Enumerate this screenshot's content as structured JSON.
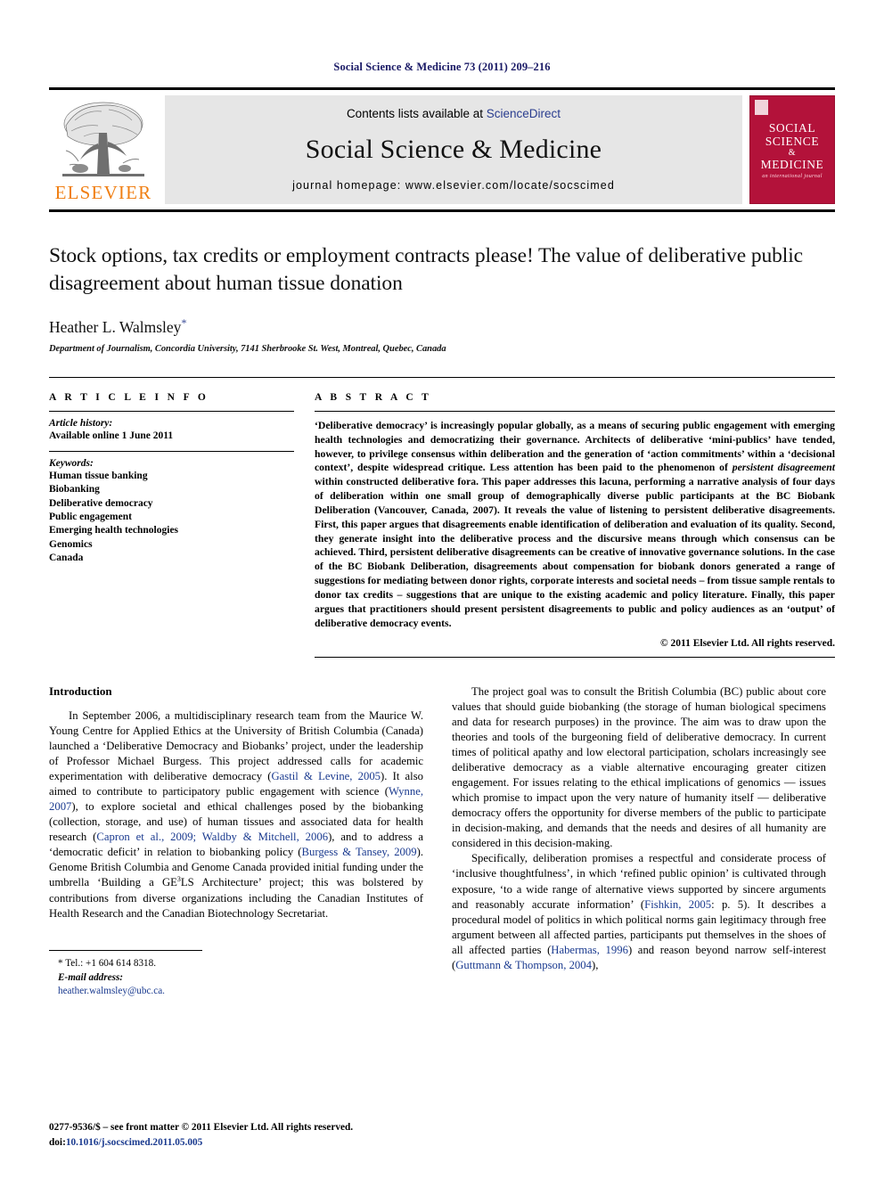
{
  "running_head": "Social Science & Medicine 73 (2011) 209–216",
  "masthead": {
    "publisher_name": "ELSEVIER",
    "contents_prefix": "Contents lists available at ",
    "sciencedirect": "ScienceDirect",
    "journal_name": "Social Science & Medicine",
    "homepage": "journal homepage: www.elsevier.com/locate/socscimed",
    "cover": {
      "line1": "SOCIAL",
      "line2": "SCIENCE",
      "amp": "&",
      "line3": "MEDICINE",
      "subtitle": "an international journal"
    },
    "cover_color": "#b3123a",
    "elsevier_color": "#F07F13"
  },
  "article": {
    "title": "Stock options, tax credits or employment contracts please! The value of deliberative public disagreement about human tissue donation",
    "author": "Heather L. Walmsley",
    "author_marker": "*",
    "affiliation": "Department of Journalism, Concordia University, 7141 Sherbrooke St. West, Montreal, Quebec, Canada"
  },
  "info": {
    "heading": "A R T I C L E   I N F O",
    "history_label": "Article history:",
    "history_value": "Available online 1 June 2011",
    "keywords_label": "Keywords:",
    "keywords": [
      "Human tissue banking",
      "Biobanking",
      "Deliberative democracy",
      "Public engagement",
      "Emerging health technologies",
      "Genomics",
      "Canada"
    ]
  },
  "abstract": {
    "heading": "A B S T R A C T",
    "part1": "‘Deliberative democracy’ is increasingly popular globally, as a means of securing public engagement with emerging health technologies and democratizing their governance. Architects of deliberative ‘mini-publics’ have tended, however, to privilege consensus within deliberation and the generation of ‘action commitments’ within a ‘decisional context’, despite widespread critique. Less attention has been paid to the phenomenon of ",
    "italic1": "persistent disagreement",
    "part2": " within constructed deliberative fora. This paper addresses this lacuna, performing a narrative analysis of four days of deliberation within one small group of demographically diverse public participants at the BC Biobank Deliberation (Vancouver, Canada, 2007). It reveals the value of listening to persistent deliberative disagreements. First, this paper argues that disagreements enable identification of deliberation and evaluation of its quality. Second, they generate insight into the deliberative process and the discursive means through which consensus can be achieved. Third, persistent deliberative disagreements can be creative of innovative governance solutions. In the case of the BC Biobank Deliberation, disagreements about compensation for biobank donors generated a range of suggestions for mediating between donor rights, corporate interests and societal needs – from tissue sample rentals to donor tax credits – suggestions that are unique to the existing academic and policy literature. Finally, this paper argues that practitioners should present persistent disagreements to public and policy audiences as an ‘output’ of deliberative democracy events.",
    "copyright": "© 2011 Elsevier Ltd. All rights reserved."
  },
  "body": {
    "section_heading": "Introduction",
    "left_para1_a": "In September 2006, a multidisciplinary research team from the Maurice W. Young Centre for Applied Ethics at the University of British Columbia (Canada) launched a ‘Deliberative Democracy and Biobanks’ project, under the leadership of Professor Michael Burgess. This project addressed calls for academic experimentation with deliberative democracy (",
    "cite_gastil": "Gastil & Levine, 2005",
    "left_para1_b": "). It also aimed to contribute to participatory public engagement with science (",
    "cite_wynne": "Wynne, 2007",
    "left_para1_c": "), to explore societal and ethical challenges posed by the biobanking (collection, storage, and use) of human tissues and associated data for health research (",
    "cite_capron": "Capron et al., 2009; Waldby & Mitchell, 2006",
    "left_para1_d": "), and to address a ‘democratic deficit’ in relation to biobanking policy (",
    "cite_burgess": "Burgess & Tansey, 2009",
    "left_para1_e": "). Genome British Columbia and Genome Canada provided initial funding under the umbrella ‘Building a GE",
    "ge3_sup": "3",
    "left_para1_f": "LS Architecture’ project; this was bolstered by contributions from diverse organizations including the Canadian Institutes of Health Research and the Canadian Biotechnology Secretariat.",
    "right_para1": "The project goal was to consult the British Columbia (BC) public about core values that should guide biobanking (the storage of human biological specimens and data for research purposes) in the province. The aim was to draw upon the theories and tools of the burgeoning field of deliberative democracy. In current times of political apathy and low electoral participation, scholars increasingly see deliberative democracy as a viable alternative encouraging greater citizen engagement. For issues relating to the ethical implications of genomics — issues which promise to impact upon the very nature of humanity itself — deliberative democracy offers the opportunity for diverse members of the public to participate in decision-making, and demands that the needs and desires of all humanity are considered in this decision-making.",
    "right_para2_a": "Specifically, deliberation promises a respectful and considerate process of ‘inclusive thoughtfulness’, in which ‘refined public opinion’ is cultivated through exposure, ‘to a wide range of alternative views supported by sincere arguments and reasonably accurate information’ (",
    "cite_fishkin": "Fishkin, 2005",
    "right_para2_b": ": p. 5). It describes a procedural model of politics in which political norms gain legitimacy through free argument between all affected parties, participants put themselves in the shoes of all affected parties (",
    "cite_habermas": "Habermas, 1996",
    "right_para2_c": ") and reason beyond narrow self-interest (",
    "cite_guttmann": "Guttmann & Thompson, 2004",
    "right_para2_d": "),"
  },
  "footnote": {
    "tel": "* Tel.: +1 604 614 8318.",
    "email_label": "E-mail address:",
    "email": "heather.walmsley@ubc.ca."
  },
  "footer": {
    "front_matter": "0277-9536/$ – see front matter © 2011 Elsevier Ltd. All rights reserved.",
    "doi_label": "doi:",
    "doi_value": "10.1016/j.socscimed.2011.05.005"
  }
}
